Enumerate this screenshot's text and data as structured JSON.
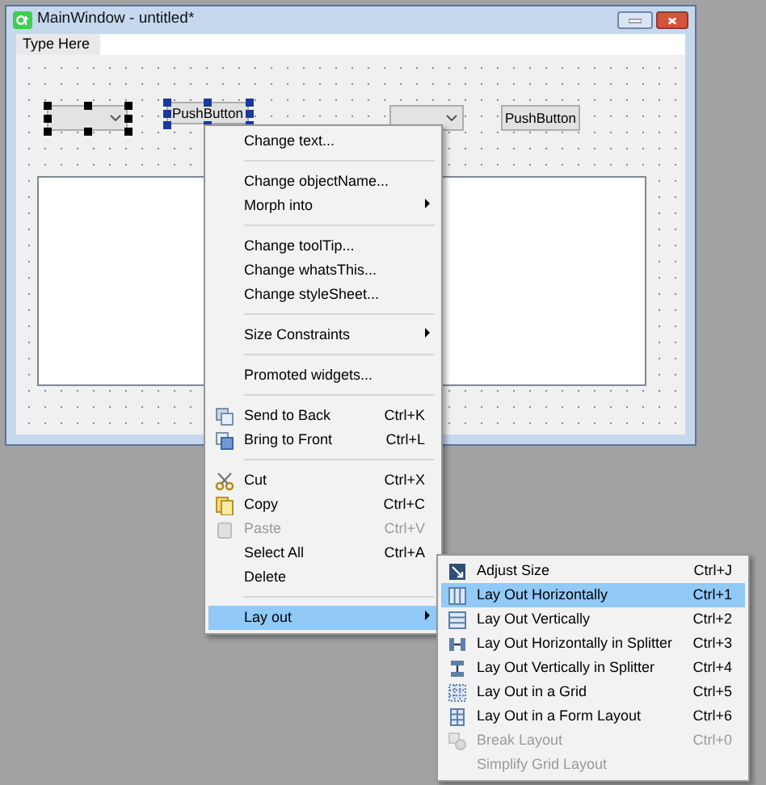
{
  "window": {
    "title": "MainWindow - untitled*"
  },
  "menu_bar": {
    "placeholder_item": "Type Here"
  },
  "form": {
    "widgets": [
      {
        "kind": "combo",
        "selected": true,
        "primary": true
      },
      {
        "kind": "button",
        "text": "PushButton",
        "selected": true,
        "primary": false
      },
      {
        "kind": "combo",
        "selected": false
      },
      {
        "kind": "button",
        "text": "PushButton",
        "selected": false
      },
      {
        "kind": "textedit",
        "selected": false
      }
    ]
  },
  "context_menu": {
    "items": [
      {
        "kind": "item",
        "text": "Change text...",
        "has_submenu": false,
        "disabled": false,
        "selected": false
      },
      {
        "kind": "separator"
      },
      {
        "kind": "item",
        "text": "Change objectName...",
        "has_submenu": false,
        "disabled": false,
        "selected": false
      },
      {
        "kind": "item",
        "text": "Morph into",
        "has_submenu": true,
        "disabled": false,
        "selected": false
      },
      {
        "kind": "separator"
      },
      {
        "kind": "item",
        "text": "Change toolTip...",
        "has_submenu": false,
        "disabled": false,
        "selected": false
      },
      {
        "kind": "item",
        "text": "Change whatsThis...",
        "has_submenu": false,
        "disabled": false,
        "selected": false
      },
      {
        "kind": "item",
        "text": "Change styleSheet...",
        "has_submenu": false,
        "disabled": false,
        "selected": false
      },
      {
        "kind": "separator"
      },
      {
        "kind": "item",
        "text": "Size Constraints",
        "has_submenu": true,
        "disabled": false,
        "selected": false
      },
      {
        "kind": "separator"
      },
      {
        "kind": "item",
        "text": "Promoted widgets...",
        "has_submenu": false,
        "disabled": false,
        "selected": false
      },
      {
        "kind": "separator"
      },
      {
        "kind": "item",
        "text": "Send to Back",
        "shortcut": "Ctrl+K",
        "has_submenu": false,
        "disabled": false,
        "selected": false
      },
      {
        "kind": "item",
        "text": "Bring to Front",
        "shortcut": "Ctrl+L",
        "has_submenu": false,
        "disabled": false,
        "selected": false
      },
      {
        "kind": "separator"
      },
      {
        "kind": "item",
        "text": "Cut",
        "shortcut": "Ctrl+X",
        "has_submenu": false,
        "disabled": false,
        "selected": false
      },
      {
        "kind": "item",
        "text": "Copy",
        "shortcut": "Ctrl+C",
        "has_submenu": false,
        "disabled": false,
        "selected": false
      },
      {
        "kind": "item",
        "text": "Paste",
        "shortcut": "Ctrl+V",
        "has_submenu": false,
        "disabled": true,
        "selected": false
      },
      {
        "kind": "item",
        "text": "Select All",
        "shortcut": "Ctrl+A",
        "has_submenu": false,
        "disabled": false,
        "selected": false
      },
      {
        "kind": "item",
        "text": "Delete",
        "has_submenu": false,
        "disabled": false,
        "selected": false
      },
      {
        "kind": "separator"
      },
      {
        "kind": "item",
        "text": "Lay out",
        "has_submenu": true,
        "disabled": false,
        "selected": true
      }
    ]
  },
  "submenu": {
    "items": [
      {
        "kind": "item",
        "text": "Adjust Size",
        "shortcut": "Ctrl+J",
        "disabled": false,
        "selected": false
      },
      {
        "kind": "item",
        "text": "Lay Out Horizontally",
        "shortcut": "Ctrl+1",
        "disabled": false,
        "selected": true
      },
      {
        "kind": "item",
        "text": "Lay Out Vertically",
        "shortcut": "Ctrl+2",
        "disabled": false,
        "selected": false
      },
      {
        "kind": "item",
        "text": "Lay Out Horizontally in Splitter",
        "shortcut": "Ctrl+3",
        "disabled": false,
        "selected": false
      },
      {
        "kind": "item",
        "text": "Lay Out Vertically in Splitter",
        "shortcut": "Ctrl+4",
        "disabled": false,
        "selected": false
      },
      {
        "kind": "item",
        "text": "Lay Out in a Grid",
        "shortcut": "Ctrl+5",
        "disabled": false,
        "selected": false
      },
      {
        "kind": "item",
        "text": "Lay Out in a Form Layout",
        "shortcut": "Ctrl+6",
        "disabled": false,
        "selected": false
      },
      {
        "kind": "item",
        "text": "Break Layout",
        "shortcut": "Ctrl+0",
        "disabled": true,
        "selected": false
      },
      {
        "kind": "item",
        "text": "Simplify Grid Layout",
        "disabled": true,
        "selected": false
      }
    ]
  }
}
